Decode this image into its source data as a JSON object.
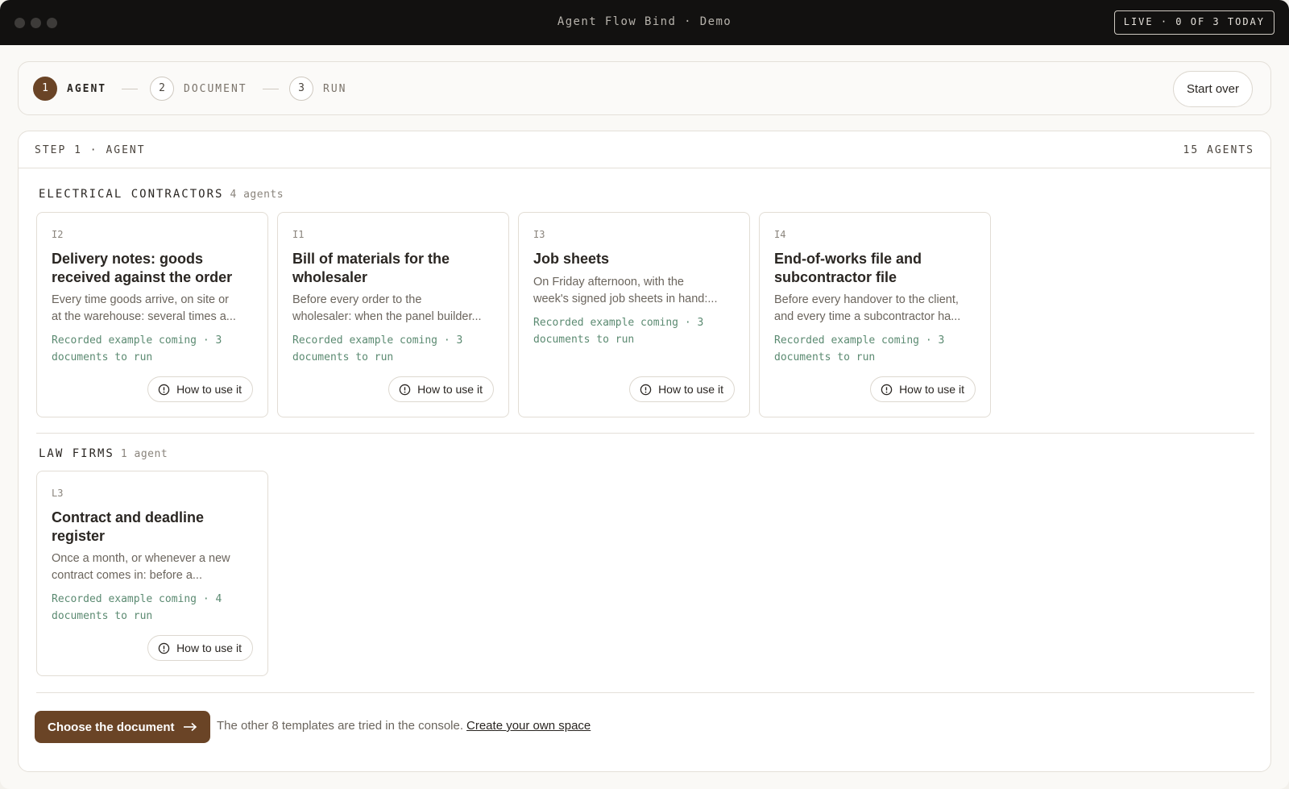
{
  "window": {
    "title": "Agent Flow Bind · Demo",
    "live_badge": "LIVE · 0 OF 3 TODAY"
  },
  "stepper": {
    "steps": [
      {
        "num": "1",
        "label": "AGENT",
        "active": true
      },
      {
        "num": "2",
        "label": "DOCUMENT",
        "active": false
      },
      {
        "num": "3",
        "label": "RUN",
        "active": false
      }
    ],
    "start_over": "Start over"
  },
  "panel": {
    "header_left": "STEP 1 · AGENT",
    "header_right": "15 AGENTS",
    "groups": [
      {
        "name": "ELECTRICAL CONTRACTORS",
        "count": "4 agents",
        "cards": [
          {
            "code": "I2",
            "title": "Delivery notes: goods received against the order",
            "desc_lines": [
              "Every time goods arrive, on site or",
              "at the warehouse: several times a..."
            ],
            "meta": "Recorded example coming · 3 documents to run",
            "button": "How to use it"
          },
          {
            "code": "I1",
            "title": "Bill of materials for the wholesaler",
            "desc_lines": [
              "Before every order to the",
              "wholesaler: when the panel builder..."
            ],
            "meta": "Recorded example coming · 3 documents to run",
            "button": "How to use it"
          },
          {
            "code": "I3",
            "title": "Job sheets",
            "desc_lines": [
              "On Friday afternoon, with the",
              "week's signed job sheets in hand:..."
            ],
            "meta": "Recorded example coming · 3 documents to run",
            "button": "How to use it"
          },
          {
            "code": "I4",
            "title": "End-of-works file and subcontractor file",
            "desc_lines": [
              "Before every handover to the client,",
              "and every time a subcontractor ha..."
            ],
            "meta": "Recorded example coming · 3 documents to run",
            "button": "How to use it"
          }
        ]
      },
      {
        "name": "LAW FIRMS",
        "count": "1 agent",
        "cards": [
          {
            "code": "L3",
            "title": "Contract and deadline register",
            "desc_lines": [
              "Once a month, or whenever a new",
              "contract comes in: before a..."
            ],
            "meta": "Recorded example coming · 4 documents to run",
            "button": "How to use it"
          }
        ]
      }
    ]
  },
  "footer": {
    "primary_button": "Choose the document",
    "note": "The other 8 templates are tried in the console.",
    "link": "Create your own space"
  },
  "colors": {
    "accent": "#6a4426",
    "meta_green": "#5b8a71",
    "titlebar": "#121110"
  },
  "icons": {
    "info": "info-circle-icon",
    "arrow": "arrow-right-icon"
  }
}
